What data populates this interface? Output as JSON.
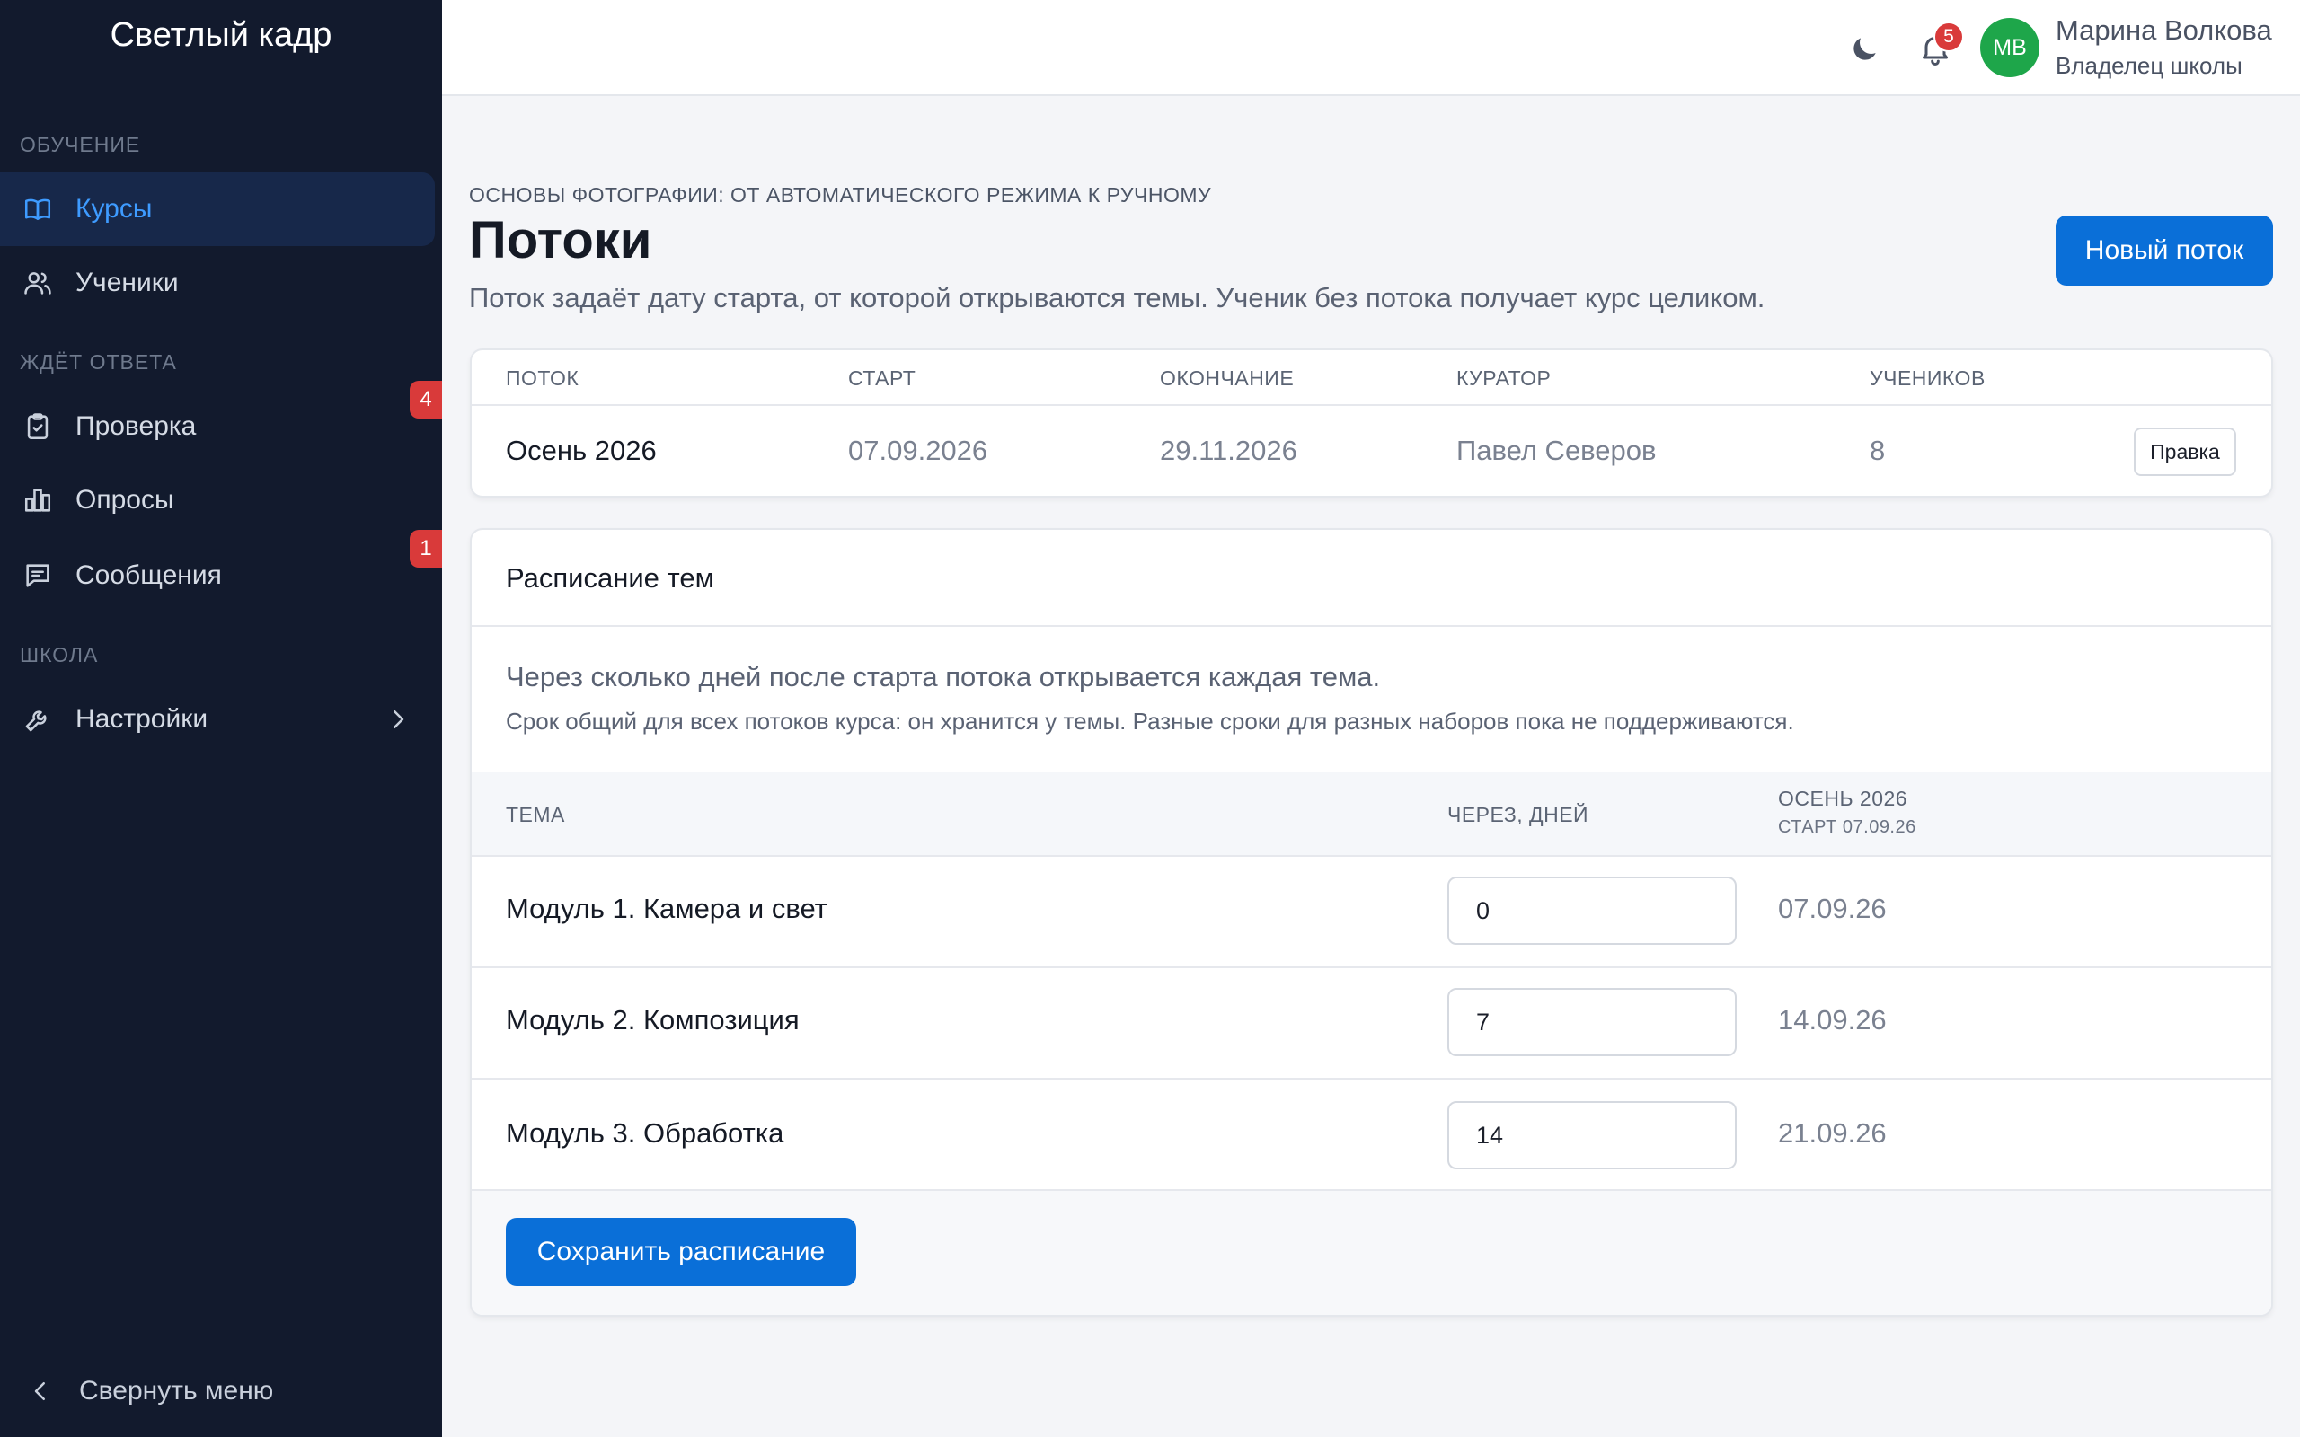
{
  "app": {
    "brand": "Светлый кадр"
  },
  "sidebar": {
    "sections": [
      {
        "label": "ОБУЧЕНИЕ"
      },
      {
        "label": "ЖДЁТ ОТВЕТА"
      },
      {
        "label": "ШКОЛА"
      }
    ],
    "items": [
      {
        "label": "Курсы",
        "icon": "book-icon",
        "active": true
      },
      {
        "label": "Ученики",
        "icon": "users-icon"
      },
      {
        "label": "Проверка",
        "icon": "clipboard-check-icon",
        "badge": "4"
      },
      {
        "label": "Опросы",
        "icon": "bar-chart-icon"
      },
      {
        "label": "Сообщения",
        "icon": "message-icon",
        "badge": "1"
      },
      {
        "label": "Настройки",
        "icon": "wrench-icon"
      }
    ],
    "collapse_label": "Свернуть меню"
  },
  "header": {
    "notifications_count": "5",
    "avatar_initials": "МВ",
    "user_name": "Марина Волкова",
    "user_role": "Владелец школы"
  },
  "page": {
    "eyebrow": "ОСНОВЫ ФОТОГРАФИИ: ОТ АВТОМАТИЧЕСКОГО РЕЖИМА К РУЧНОМУ",
    "title": "Потоки",
    "description": "Поток задаёт дату старта, от которой открываются темы. Ученик без потока получает курс целиком.",
    "new_stream_label": "Новый поток"
  },
  "streams": {
    "columns": [
      "ПОТОК",
      "СТАРТ",
      "ОКОНЧАНИЕ",
      "КУРАТОР",
      "УЧЕНИКОВ"
    ],
    "rows": [
      {
        "name": "Осень 2026",
        "start": "07.09.2026",
        "end": "29.11.2026",
        "curator": "Павел Северов",
        "students": "8",
        "edit_label": "Правка"
      }
    ]
  },
  "schedule": {
    "title": "Расписание тем",
    "description": "Через сколько дней после старта потока открывается каждая тема.",
    "note": "Срок общий для всех потоков курса: он хранится у темы. Разные сроки для разных наборов пока не поддерживаются.",
    "columns": {
      "topic": "ТЕМА",
      "days": "ЧЕРЕЗ, ДНЕЙ",
      "stream": "ОСЕНЬ 2026",
      "stream_sub": "СТАРТ 07.09.26"
    },
    "rows": [
      {
        "topic": "Модуль 1. Камера и свет",
        "days": "0",
        "date": "07.09.26"
      },
      {
        "topic": "Модуль 2. Композиция",
        "days": "7",
        "date": "14.09.26"
      },
      {
        "topic": "Модуль 3. Обработка",
        "days": "14",
        "date": "21.09.26"
      }
    ],
    "save_label": "Сохранить расписание"
  },
  "colors": {
    "accent": "#0a6fd8",
    "sidebar_bg": "#121a2d",
    "badge": "#d93a3a",
    "avatar": "#1ea64a"
  }
}
